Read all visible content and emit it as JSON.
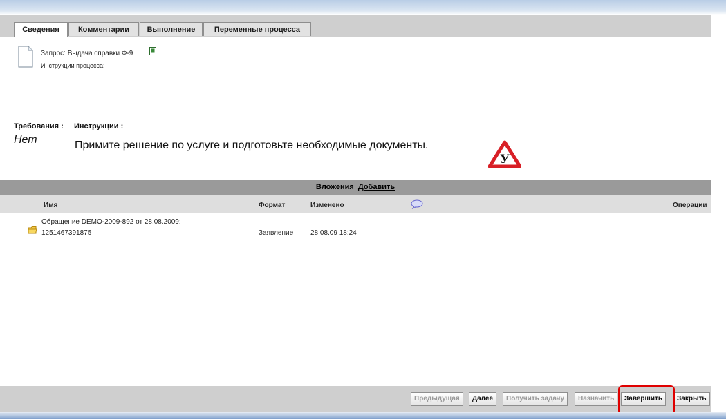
{
  "tabs": [
    {
      "label": "Сведения",
      "active": true
    },
    {
      "label": "Комментарии",
      "active": false
    },
    {
      "label": "Выполнение",
      "active": false
    },
    {
      "label": "Переменные процесса",
      "active": false
    }
  ],
  "request": {
    "title": "Запрос: Выдача справки Ф-9",
    "instructions_label": "Инструкции процесса:"
  },
  "requirements": {
    "label": "Требования :",
    "value": "Нет"
  },
  "instructions": {
    "label": "Инструкции :",
    "value": "Примите решение по услуге и подготовьте необходимые документы.",
    "badge_letter": "У"
  },
  "attachments": {
    "title": "Вложения",
    "add_label": "Добавить",
    "columns": {
      "name": "Имя",
      "format": "Формат",
      "modified": "Изменено",
      "operations": "Операции"
    },
    "rows": [
      {
        "name_line1": "Обращение DEMO-2009-892 от 28.08.2009:",
        "name_line2": "1251467391875",
        "format": "Заявление",
        "modified": "28.08.09 18:24"
      }
    ]
  },
  "buttons": {
    "previous": "Предыдущая",
    "next": "Далее",
    "get_task": "Получить задачу",
    "assign": "Назначить",
    "finish": "Завершить",
    "close": "Закрыть"
  },
  "colors": {
    "highlight": "#e00000",
    "warning_red": "#d81f26"
  }
}
